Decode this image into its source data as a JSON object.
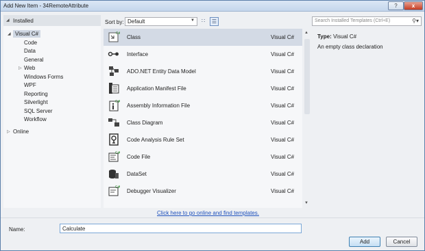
{
  "window": {
    "title": "Add New Item - 34RemoteAttribute",
    "help_label": "?",
    "close_label": "x"
  },
  "tree": {
    "installed_label": "Installed",
    "visual_csharp_label": "Visual C#",
    "children": [
      "Code",
      "Data",
      "General",
      "Web",
      "Windows Forms",
      "WPF",
      "Reporting",
      "Silverlight",
      "SQL Server",
      "Workflow"
    ],
    "online_label": "Online"
  },
  "sortbar": {
    "label": "Sort by:",
    "selected": "Default"
  },
  "templates": [
    {
      "name": "Class",
      "lang": "Visual C#",
      "icon": "class-icon"
    },
    {
      "name": "Interface",
      "lang": "Visual C#",
      "icon": "interface-icon"
    },
    {
      "name": "ADO.NET Entity Data Model",
      "lang": "Visual C#",
      "icon": "entity-model-icon"
    },
    {
      "name": "Application Manifest File",
      "lang": "Visual C#",
      "icon": "manifest-icon"
    },
    {
      "name": "Assembly Information File",
      "lang": "Visual C#",
      "icon": "assembly-info-icon"
    },
    {
      "name": "Class Diagram",
      "lang": "Visual C#",
      "icon": "class-diagram-icon"
    },
    {
      "name": "Code Analysis Rule Set",
      "lang": "Visual C#",
      "icon": "rule-set-icon"
    },
    {
      "name": "Code File",
      "lang": "Visual C#",
      "icon": "code-file-icon"
    },
    {
      "name": "DataSet",
      "lang": "Visual C#",
      "icon": "dataset-icon"
    },
    {
      "name": "Debugger Visualizer",
      "lang": "Visual C#",
      "icon": "debugger-visualizer-icon"
    }
  ],
  "online_link": "Click here to go online and find templates.",
  "details": {
    "search_placeholder": "Search Installed Templates (Ctrl+E)",
    "type_label": "Type:",
    "type_value": "Visual C#",
    "description": "An empty class declaration"
  },
  "footer": {
    "name_label": "Name:",
    "name_value": "Calculate",
    "add_label": "Add",
    "cancel_label": "Cancel"
  }
}
